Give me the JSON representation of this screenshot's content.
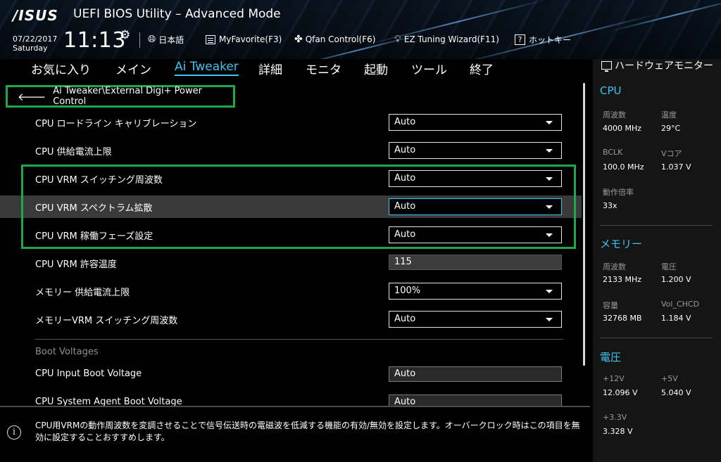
{
  "header": {
    "logo": "/ISUS",
    "title": "UEFI BIOS Utility – Advanced Mode",
    "date": "07/22/2017",
    "day": "Saturday",
    "time": "11:13",
    "buttons": {
      "language": "日本語",
      "myfavorite": "MyFavorite(F3)",
      "qfan": "Qfan Control(F6)",
      "ez_tuning": "EZ Tuning Wizard(F11)",
      "hotkeys": "ホットキー"
    }
  },
  "nav": {
    "tabs": [
      "お気に入り",
      "メイン",
      "Ai Tweaker",
      "詳細",
      "モニタ",
      "起動",
      "ツール",
      "終了"
    ],
    "active": "Ai Tweaker"
  },
  "breadcrumb": "Ai Tweaker\\External Digi+ Power Control",
  "settings": [
    {
      "label": "CPU ロードライン キャリブレーション",
      "value": "Auto",
      "type": "select"
    },
    {
      "label": "CPU 供給電流上限",
      "value": "Auto",
      "type": "select"
    },
    {
      "label": "CPU VRM スイッチング周波数",
      "value": "Auto",
      "type": "select"
    },
    {
      "label": "CPU VRM スペクトラム拡散",
      "value": "Auto",
      "type": "select"
    },
    {
      "label": "CPU VRM 稼働フェーズ設定",
      "value": "Auto",
      "type": "select"
    },
    {
      "label": "CPU VRM 許容温度",
      "value": "115",
      "type": "number"
    },
    {
      "label": "メモリー 供給電流上限",
      "value": "100%",
      "type": "select"
    },
    {
      "label": "メモリーVRM スイッチング周波数",
      "value": "Auto",
      "type": "select"
    }
  ],
  "boot_section": {
    "title": "Boot Voltages",
    "items": [
      {
        "label": "CPU Input Boot Voltage",
        "value": "Auto"
      },
      {
        "label": "CPU System Agent Boot Voltage",
        "value": "Auto"
      }
    ]
  },
  "help_text": "CPU用VRMの動作周波数を変調させることで信号伝送時の電磁波を低減する機能の有効/無効を設定します。オーバークロック時はこの項目を無効に設定することおすすめします。",
  "hw_monitor": {
    "title": "ハードウェアモニター",
    "cpu": {
      "heading": "CPU",
      "freq_label": "周波数",
      "freq": "4000 MHz",
      "temp_label": "温度",
      "temp": "29°C",
      "bclk_label": "BCLK",
      "bclk": "100.0 MHz",
      "vcore_label": "Vコア",
      "vcore": "1.037 V",
      "ratio_label": "動作倍率",
      "ratio": "33x"
    },
    "memory": {
      "heading": "メモリー",
      "freq_label": "周波数",
      "freq": "2133 MHz",
      "volt_label": "電圧",
      "volt": "1.200 V",
      "cap_label": "容量",
      "cap": "32768 MB",
      "chcd_label": "Vol_CHCD",
      "chcd": "1.184 V"
    },
    "voltage": {
      "heading": "電圧",
      "v12_label": "+12V",
      "v12": "12.096 V",
      "v5_label": "+5V",
      "v5": "5.040 V",
      "v33_label": "+3.3V",
      "v33": "3.328 V"
    }
  }
}
